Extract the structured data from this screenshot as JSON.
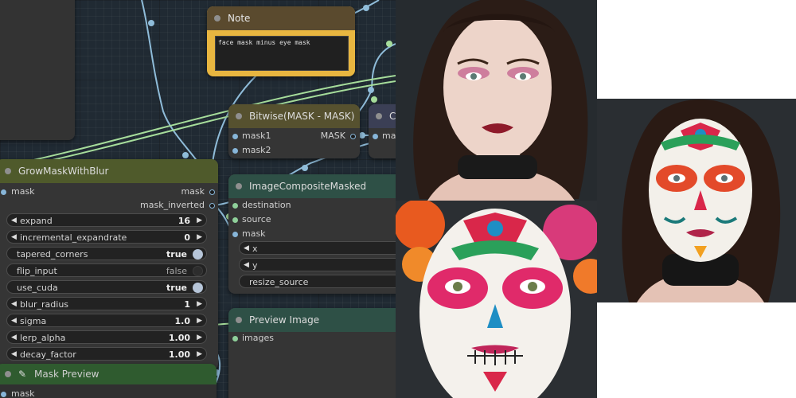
{
  "note": {
    "title": "Note",
    "text": "face mask minus eye mask"
  },
  "bitwise": {
    "title": "Bitwise(MASK - MASK)",
    "inputs": [
      "mask1",
      "mask2"
    ],
    "output": "MASK"
  },
  "clipped_node": {
    "title": "C",
    "input": "mas"
  },
  "grow": {
    "title": "GrowMaskWithBlur",
    "input": "mask",
    "outputs": [
      "mask",
      "mask_inverted"
    ],
    "widgets": [
      {
        "label": "expand",
        "value": "16",
        "kind": "number"
      },
      {
        "label": "incremental_expandrate",
        "value": "0",
        "kind": "number"
      },
      {
        "label": "tapered_corners",
        "value": "true",
        "kind": "toggle"
      },
      {
        "label": "flip_input",
        "value": "false",
        "kind": "toggle"
      },
      {
        "label": "use_cuda",
        "value": "true",
        "kind": "toggle"
      },
      {
        "label": "blur_radius",
        "value": "1",
        "kind": "number"
      },
      {
        "label": "sigma",
        "value": "1.0",
        "kind": "number"
      },
      {
        "label": "lerp_alpha",
        "value": "1.00",
        "kind": "number"
      },
      {
        "label": "decay_factor",
        "value": "1.00",
        "kind": "number"
      }
    ]
  },
  "composite": {
    "title": "ImageCompositeMasked",
    "inputs": [
      "destination",
      "source",
      "mask"
    ],
    "widgets": [
      {
        "label": "x",
        "kind": "number"
      },
      {
        "label": "y",
        "kind": "number"
      },
      {
        "label": "resize_source",
        "kind": "combo"
      }
    ]
  },
  "preview_image": {
    "title": "Preview Image",
    "input": "images"
  },
  "mask_preview": {
    "title": "Mask Preview",
    "input": "mask"
  },
  "colors": {
    "canvas": "#202a33",
    "node_body": "#353535",
    "note_title": "#5a4a2e",
    "note_body": "#e8b640",
    "bitwise_title": "#56512f",
    "grow_title": "#4f5a2b",
    "composite_title": "#2e5046",
    "mask_preview_title": "#2f5b2f",
    "mask_link": "#8fbcd9",
    "image_link": "#a6dd9b"
  }
}
